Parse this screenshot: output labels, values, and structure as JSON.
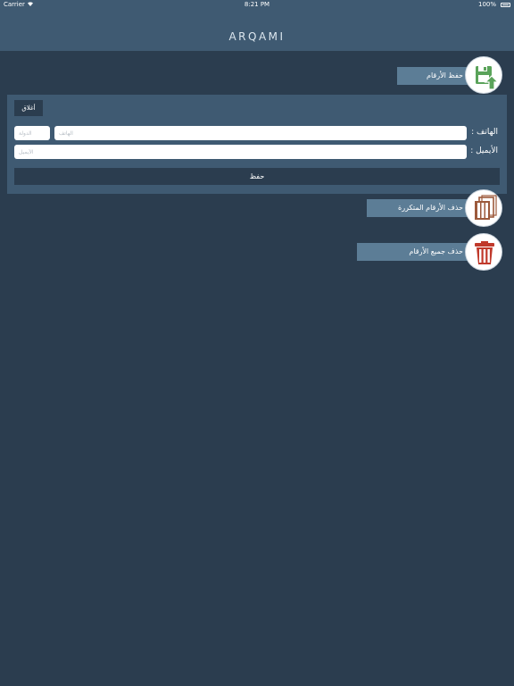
{
  "status_bar": {
    "carrier": "Carrier",
    "time": "8:21 PM",
    "battery": "100%"
  },
  "nav": {
    "title": "ARQAMI"
  },
  "actions": {
    "save_numbers": "حفظ الأرقام",
    "delete_duplicates": "حذف الأرقام المتكررة",
    "delete_all": "حذف جميع الأرقام"
  },
  "form": {
    "close_label": "أغلاق",
    "phone_label": "الهاتف :",
    "email_label": "الأيميل :",
    "phone_placeholder": "الهاتف",
    "country_placeholder": "الدولة",
    "email_placeholder": "الأيميل",
    "save_label": "حفظ"
  },
  "colors": {
    "background": "#2b3d4f",
    "nav": "#3f5a72",
    "button": "#5c7d96",
    "save_icon": "#5aa35a",
    "duplicates_icon": "#9c5a3c",
    "delete_icon": "#c0392b"
  }
}
